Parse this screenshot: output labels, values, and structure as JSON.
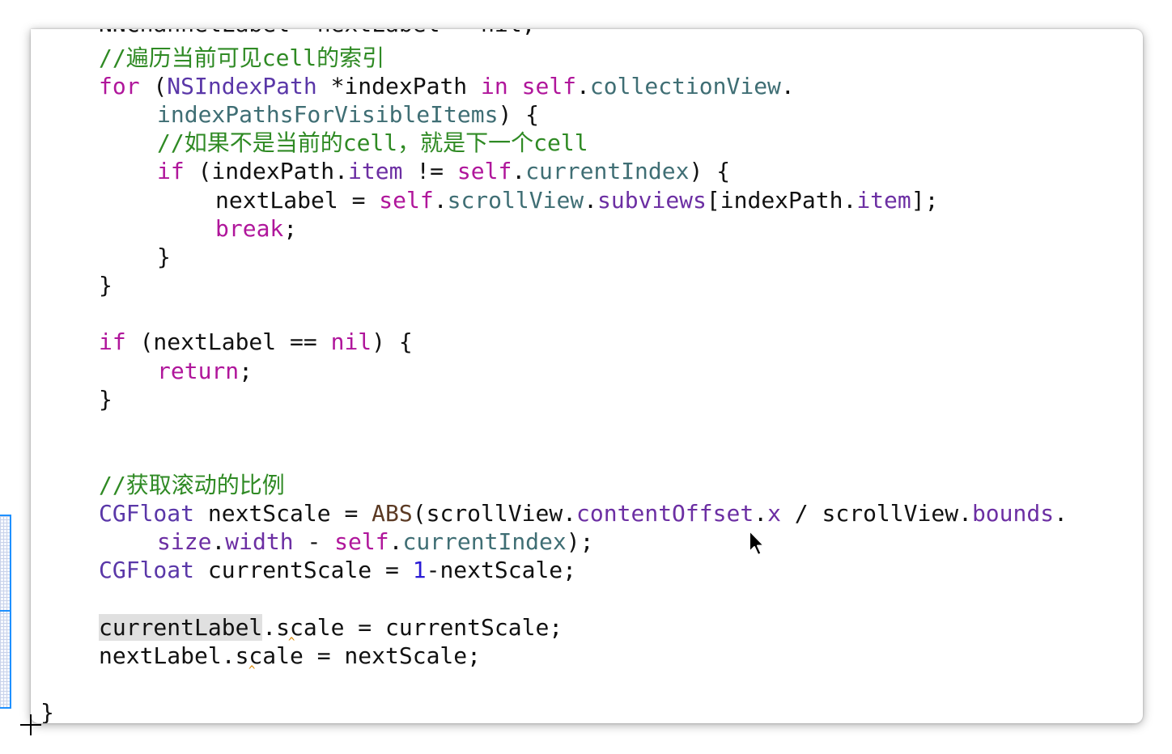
{
  "editor": {
    "language": "Objective-C",
    "clipped_top_line": "NNChannelLabel *nextLabel = nil;",
    "lines": [
      {
        "key": "comment-traverse",
        "tokens": [
          {
            "text": "//遍历当前可见cell的索引",
            "class": "comment"
          }
        ]
      },
      {
        "key": "for-statement",
        "tokens": [
          {
            "text": "for",
            "class": "kw"
          },
          {
            "text": " (",
            "class": "plain"
          },
          {
            "text": "NSIndexPath",
            "class": "type"
          },
          {
            "text": " *indexPath ",
            "class": "plain"
          },
          {
            "text": "in",
            "class": "kw"
          },
          {
            "text": " ",
            "class": "plain"
          },
          {
            "text": "self",
            "class": "kw"
          },
          {
            "text": ".",
            "class": "plain"
          },
          {
            "text": "collectionView",
            "class": "ivar"
          },
          {
            "text": ".",
            "class": "plain"
          }
        ]
      },
      {
        "key": "for-statement-continued",
        "tokens": [
          {
            "text": "indexPathsForVisibleItems",
            "class": "ivar"
          },
          {
            "text": ") {",
            "class": "plain"
          }
        ]
      },
      {
        "key": "comment-next-cell",
        "tokens": [
          {
            "text": "//如果不是当前的cell，就是下一个cell",
            "class": "comment"
          }
        ]
      },
      {
        "key": "if-not-current",
        "tokens": [
          {
            "text": "if",
            "class": "kw"
          },
          {
            "text": " (indexPath.",
            "class": "plain"
          },
          {
            "text": "item",
            "class": "prop"
          },
          {
            "text": " != ",
            "class": "plain"
          },
          {
            "text": "self",
            "class": "kw"
          },
          {
            "text": ".",
            "class": "plain"
          },
          {
            "text": "currentIndex",
            "class": "ivar"
          },
          {
            "text": ") {",
            "class": "plain"
          }
        ]
      },
      {
        "key": "assign-next-label",
        "tokens": [
          {
            "text": "nextLabel = ",
            "class": "plain"
          },
          {
            "text": "self",
            "class": "kw"
          },
          {
            "text": ".",
            "class": "plain"
          },
          {
            "text": "scrollView",
            "class": "ivar"
          },
          {
            "text": ".",
            "class": "plain"
          },
          {
            "text": "subviews",
            "class": "prop"
          },
          {
            "text": "[indexPath.",
            "class": "plain"
          },
          {
            "text": "item",
            "class": "prop"
          },
          {
            "text": "];",
            "class": "plain"
          }
        ]
      },
      {
        "key": "break-statement",
        "tokens": [
          {
            "text": "break",
            "class": "kw"
          },
          {
            "text": ";",
            "class": "plain"
          }
        ]
      },
      {
        "key": "close-if",
        "tokens": [
          {
            "text": "}",
            "class": "plain"
          }
        ]
      },
      {
        "key": "close-for",
        "tokens": [
          {
            "text": "}",
            "class": "plain"
          }
        ]
      },
      {
        "key": "if-nil-check",
        "tokens": [
          {
            "text": "if",
            "class": "kw"
          },
          {
            "text": " (nextLabel == ",
            "class": "plain"
          },
          {
            "text": "nil",
            "class": "kw"
          },
          {
            "text": ") {",
            "class": "plain"
          }
        ]
      },
      {
        "key": "return-statement",
        "tokens": [
          {
            "text": "return",
            "class": "kw"
          },
          {
            "text": ";",
            "class": "plain"
          }
        ]
      },
      {
        "key": "close-if-nil",
        "tokens": [
          {
            "text": "}",
            "class": "plain"
          }
        ]
      },
      {
        "key": "comment-scale-ratio",
        "tokens": [
          {
            "text": "//获取滚动的比例",
            "class": "comment"
          }
        ]
      },
      {
        "key": "next-scale-decl",
        "tokens": [
          {
            "text": "CGFloat",
            "class": "type"
          },
          {
            "text": " nextScale = ",
            "class": "plain"
          },
          {
            "text": "ABS",
            "class": "macro"
          },
          {
            "text": "(scrollView.",
            "class": "plain"
          },
          {
            "text": "contentOffset",
            "class": "prop"
          },
          {
            "text": ".",
            "class": "plain"
          },
          {
            "text": "x",
            "class": "prop"
          },
          {
            "text": " / scrollView.",
            "class": "plain"
          },
          {
            "text": "bounds",
            "class": "prop"
          },
          {
            "text": ".",
            "class": "plain"
          }
        ]
      },
      {
        "key": "next-scale-decl-continued",
        "tokens": [
          {
            "text": "size",
            "class": "prop"
          },
          {
            "text": ".",
            "class": "plain"
          },
          {
            "text": "width",
            "class": "prop"
          },
          {
            "text": " - ",
            "class": "plain"
          },
          {
            "text": "self",
            "class": "kw"
          },
          {
            "text": ".",
            "class": "plain"
          },
          {
            "text": "currentIndex",
            "class": "ivar"
          },
          {
            "text": ");",
            "class": "plain"
          }
        ]
      },
      {
        "key": "current-scale-decl",
        "tokens": [
          {
            "text": "CGFloat",
            "class": "type"
          },
          {
            "text": " currentScale = ",
            "class": "plain"
          },
          {
            "text": "1",
            "class": "num"
          },
          {
            "text": "-nextScale;",
            "class": "plain"
          }
        ]
      },
      {
        "key": "current-label-scale",
        "tokens": [
          {
            "text": "currentLabel",
            "class": "hl"
          },
          {
            "text": ".scale = currentScale;",
            "class": "plain"
          }
        ]
      },
      {
        "key": "next-label-scale",
        "tokens": [
          {
            "text": "nextLabel.scale = nextScale;",
            "class": "plain"
          }
        ]
      },
      {
        "key": "close-method",
        "tokens": [
          {
            "text": "}",
            "class": "plain"
          }
        ]
      }
    ]
  },
  "colors": {
    "keyword": "#b0169b",
    "type": "#5a37a8",
    "ivar": "#3f6e74",
    "property": "#6c2fa3",
    "number": "#2a1bd6",
    "comment": "#2f8a24",
    "macro": "#5b3a24",
    "plain": "#111111",
    "selection_border": "#1e90ff",
    "warning_caret": "#d98600"
  },
  "icons": {
    "mouse_cursor": "arrow-pointer-icon",
    "crosshair_cursor": "crosshair-icon",
    "warning_marker": "caret-up-icon"
  }
}
